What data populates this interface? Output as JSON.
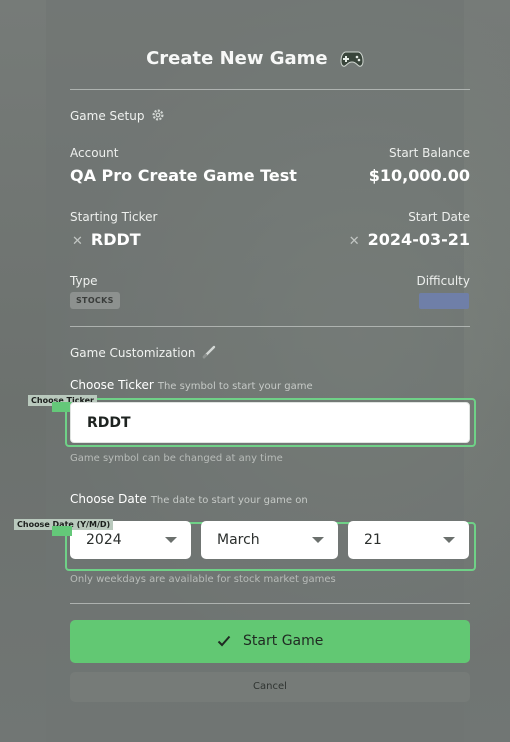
{
  "title": "Create New Game",
  "icons": {
    "title": "gamepad-icon",
    "setup": "gear-icon",
    "customization": "pencil-icon",
    "clear": "close-icon",
    "caret": "chevron-down-icon",
    "start": "check-icon"
  },
  "colors": {
    "primary": "#62c873",
    "highlight": "#6fd187",
    "difficulty": "#6f7fa8"
  },
  "setup": {
    "heading": "Game Setup",
    "account_label": "Account",
    "account_value": "QA Pro Create Game Test",
    "balance_label": "Start Balance",
    "balance_value": "$10,000.00",
    "ticker_label": "Starting Ticker",
    "ticker_value": "RDDT",
    "date_label": "Start Date",
    "date_value": "2024-03-21",
    "type_label": "Type",
    "type_value": "STOCKS",
    "difficulty_label": "Difficulty"
  },
  "customization": {
    "heading": "Game Customization",
    "ticker": {
      "label": "Choose Ticker",
      "hint": "The symbol to start your game",
      "value": "RDDT",
      "helper": "Game symbol can be changed at any time",
      "tag": "Choose Ticker"
    },
    "date": {
      "label": "Choose Date",
      "hint": "The date to start your game on",
      "year": "2024",
      "month": "March",
      "day": "21",
      "helper": "Only weekdays are available for stock market games",
      "tag": "Choose Date (Y/M/D)"
    }
  },
  "actions": {
    "start": "Start Game",
    "cancel": "Cancel"
  }
}
